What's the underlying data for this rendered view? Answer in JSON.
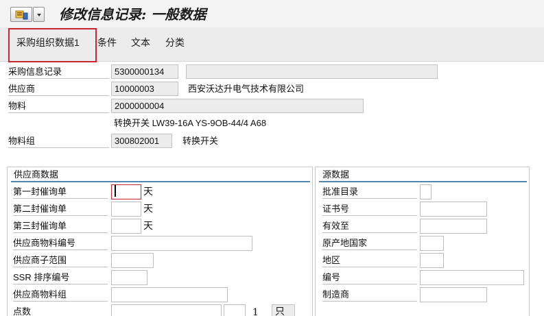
{
  "title": "修改信息记录: 一般数据",
  "tabs": [
    "采购组织数据1",
    "条件",
    "文本",
    "分类"
  ],
  "header": {
    "info_record_label": "采购信息记录",
    "info_record_value": "5300000134",
    "vendor_label": "供应商",
    "vendor_value": "10000003",
    "vendor_name": "西安沃达升电气技术有限公司",
    "material_label": "物料",
    "material_value": "2000000004",
    "material_desc": "转换开关 LW39-16A YS-9OB-44/4 A68",
    "material_group_label": "物料组",
    "material_group_value": "300802001",
    "material_group_desc": "转换开关"
  },
  "vendor_data": {
    "title": "供应商数据",
    "reminder1_label": "第一封催询单",
    "reminder2_label": "第二封催询单",
    "reminder3_label": "第三封催询单",
    "days_unit": "天",
    "vendor_material_no_label": "供应商物料编号",
    "vendor_subrange_label": "供应商子范围",
    "ssr_sort_label": "SSR 排序编号",
    "vendor_material_group_label": "供应商物料组",
    "points_label": "点数",
    "points_per": "1",
    "points_unit": "只"
  },
  "origin_data": {
    "title": "源数据",
    "approved_list_label": "批准目录",
    "certificate_no_label": "证书号",
    "valid_to_label": "有效至",
    "country_origin_label": "原产地国家",
    "region_label": "地区",
    "number_label": "编号",
    "manufacturer_label": "制造商"
  }
}
